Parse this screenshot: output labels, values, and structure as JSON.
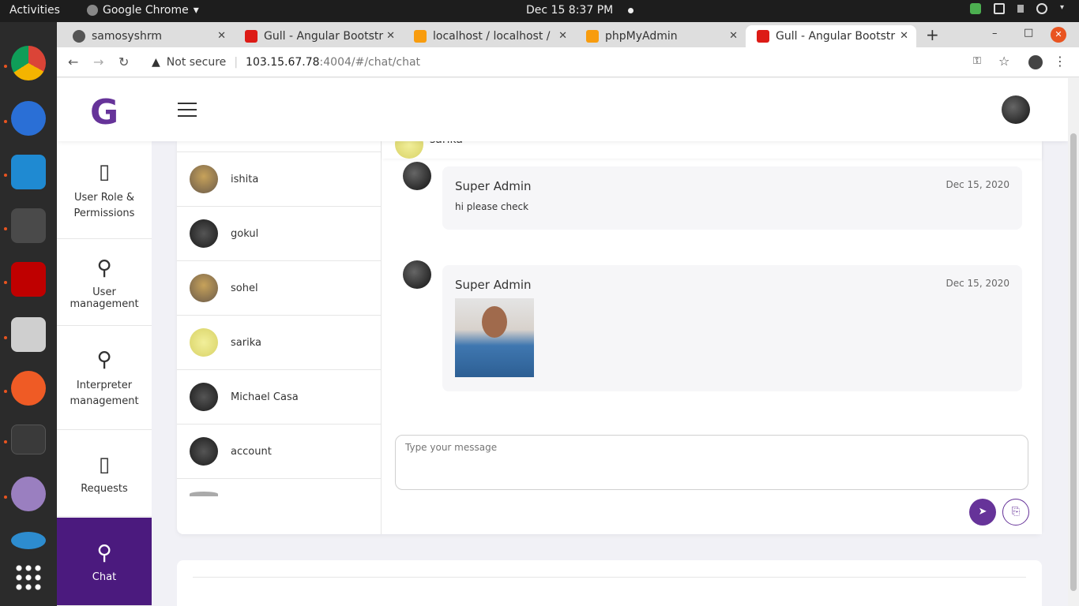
{
  "topbar": {
    "activities": "Activities",
    "app_name": "Google Chrome",
    "app_menu": "▾",
    "clock": "Dec 15  8:37 PM",
    "tray_icons": [
      "shield-icon",
      "network-icon",
      "volume-icon",
      "power-icon",
      "chevron-down-icon"
    ]
  },
  "dock": {
    "items": [
      "chrome",
      "thunderbird",
      "vscode",
      "sublime",
      "filezilla",
      "files",
      "postman",
      "terminal",
      "pidgin",
      "skype"
    ],
    "apps_grid": "show-applications-icon"
  },
  "browser": {
    "tabs": [
      {
        "label": "samosyshrm"
      },
      {
        "label": "Gull - Angular Bootstr"
      },
      {
        "label": "localhost / localhost /"
      },
      {
        "label": "phpMyAdmin"
      },
      {
        "label": "Gull - Angular Bootstr"
      }
    ],
    "new_tab": "+",
    "window_min": "–",
    "window_max": "□",
    "window_close": "✕",
    "not_secure": "Not secure",
    "url_host": "103.15.67.78",
    "url_path": ":4004/#/chat/chat",
    "back": "←",
    "forward": "→",
    "reload": "↻"
  },
  "app": {
    "logo": "G",
    "sidebar": [
      {
        "label": "User Role & Permissions",
        "icon": "book-icon"
      },
      {
        "label": "User management",
        "icon": "user-add-icon"
      },
      {
        "label": "Interpreter management",
        "icon": "user-add-icon"
      },
      {
        "label": "Requests",
        "icon": "book-icon"
      },
      {
        "label": "Chat",
        "icon": "user-add-icon",
        "active": true
      }
    ],
    "contacts": [
      {
        "name": "ishita"
      },
      {
        "name": "gokul"
      },
      {
        "name": "sohel"
      },
      {
        "name": "sarika"
      },
      {
        "name": "Michael Casa"
      },
      {
        "name": "account"
      }
    ],
    "chat_header_name": "sarika",
    "messages": [
      {
        "sender": "Super Admin",
        "date": "Dec 15, 2020",
        "text": "hi please check"
      },
      {
        "sender": "Super Admin",
        "date": "Dec 15, 2020",
        "text": ""
      }
    ],
    "composer": {
      "placeholder": "Type your message",
      "send_icon": "send-icon",
      "attach_icon": "attach-icon"
    },
    "accent": "#663399"
  }
}
